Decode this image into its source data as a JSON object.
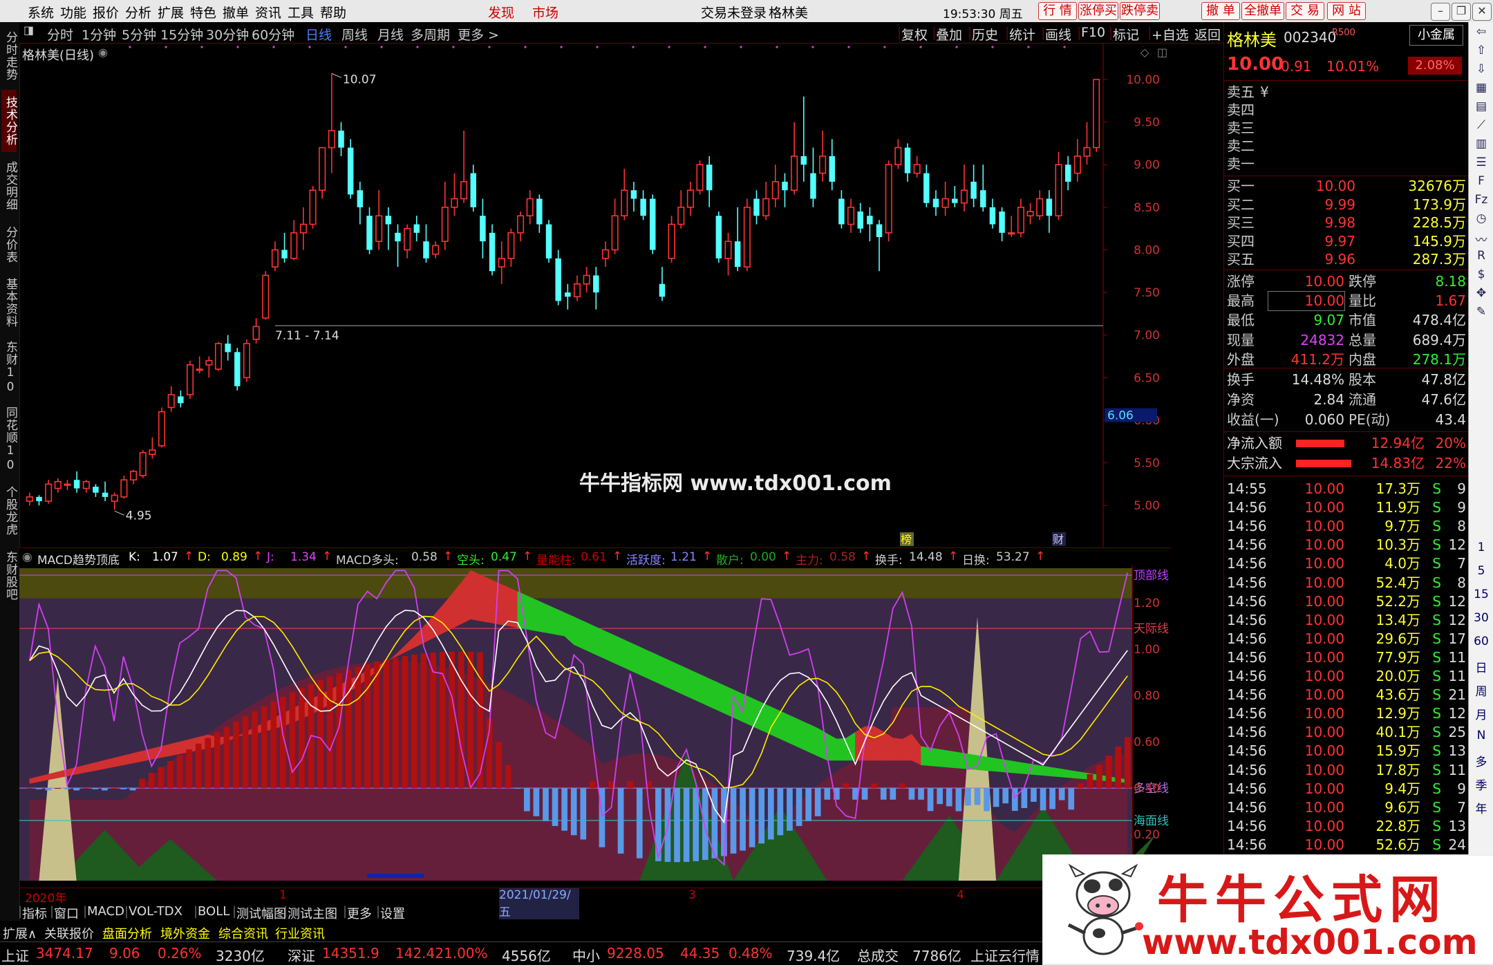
{
  "menu": {
    "items": [
      "系统",
      "功能",
      "报价",
      "分析",
      "扩展",
      "特色",
      "撤单",
      "资讯",
      "工具",
      "帮助"
    ],
    "highlight": [
      "发现",
      "市场"
    ],
    "status": "交易未登录",
    "stock_name": "格林美",
    "time": "19:53:30 周五",
    "right_buttons": [
      "行 情",
      "涨停买",
      "跌停卖",
      "撤 单",
      "全撤单",
      "交 易",
      "网 站"
    ]
  },
  "left_tabs": [
    "分时走势",
    "技术分析",
    "成交明细",
    "分价表",
    "基本资料",
    "东财10",
    "同花顺10",
    "个股龙虎",
    "东财股吧"
  ],
  "periods": [
    "分时",
    "1分钟",
    "5分钟",
    "15分钟",
    "30分钟",
    "60分钟",
    "日线",
    "周线",
    "月线",
    "多周期",
    "更多 >"
  ],
  "selected_period": "日线",
  "toolbar_right": [
    "复权",
    "叠加",
    "历史",
    "统计",
    "画线",
    "F10",
    "标记",
    "+自选",
    "返回"
  ],
  "chart_title": "格林美(日线)",
  "chart_data": [
    {
      "type": "candlestick",
      "price_axis": [
        "10.00",
        "9.50",
        "9.00",
        "8.50",
        "8.00",
        "7.50",
        "7.00",
        "6.50",
        "6.00",
        "5.50",
        "5.00"
      ],
      "ylim": [
        4.75,
        10.3
      ],
      "annotations": [
        "10.07",
        "7.11 - 7.14",
        "4.95"
      ],
      "current_price_label": "6.06",
      "markers": [
        "榜",
        "财"
      ],
      "candles": [
        [
          5.05,
          5.1,
          5.0,
          5.15
        ],
        [
          5.1,
          5.05,
          5.0,
          5.12
        ],
        [
          5.05,
          5.25,
          5.02,
          5.3
        ],
        [
          5.2,
          5.28,
          5.15,
          5.32
        ],
        [
          5.25,
          5.25,
          5.18,
          5.3
        ],
        [
          5.3,
          5.2,
          5.15,
          5.4
        ],
        [
          5.2,
          5.28,
          5.15,
          5.3
        ],
        [
          5.22,
          5.15,
          5.1,
          5.25
        ],
        [
          5.15,
          5.1,
          5.05,
          5.28
        ],
        [
          5.05,
          5.12,
          4.95,
          5.15
        ],
        [
          5.1,
          5.3,
          5.08,
          5.35
        ],
        [
          5.3,
          5.4,
          5.25,
          5.42
        ],
        [
          5.35,
          5.62,
          5.32,
          5.65
        ],
        [
          5.6,
          5.65,
          5.55,
          5.8
        ],
        [
          5.7,
          6.1,
          5.68,
          6.15
        ],
        [
          6.15,
          6.3,
          6.1,
          6.4
        ],
        [
          6.28,
          6.2,
          6.15,
          6.35
        ],
        [
          6.3,
          6.65,
          6.25,
          6.7
        ],
        [
          6.6,
          6.6,
          6.55,
          6.75
        ],
        [
          6.65,
          6.7,
          6.5,
          6.75
        ],
        [
          6.6,
          6.9,
          6.58,
          6.92
        ],
        [
          6.9,
          6.8,
          6.7,
          7.0
        ],
        [
          6.8,
          6.4,
          6.35,
          6.85
        ],
        [
          6.5,
          6.9,
          6.45,
          6.95
        ],
        [
          6.95,
          7.1,
          6.9,
          7.2
        ],
        [
          7.2,
          7.7,
          7.18,
          7.75
        ],
        [
          7.8,
          8.0,
          7.75,
          8.1
        ],
        [
          8.0,
          7.9,
          7.85,
          8.2
        ],
        [
          7.9,
          8.2,
          7.88,
          8.35
        ],
        [
          8.2,
          8.3,
          8.0,
          8.5
        ],
        [
          8.3,
          8.7,
          8.25,
          8.75
        ],
        [
          8.7,
          9.2,
          8.6,
          9.2
        ],
        [
          9.2,
          9.4,
          8.9,
          10.07
        ],
        [
          9.4,
          9.2,
          9.1,
          9.5
        ],
        [
          9.2,
          8.65,
          8.6,
          9.3
        ],
        [
          8.7,
          8.5,
          8.3,
          8.8
        ],
        [
          8.4,
          8.0,
          7.95,
          8.5
        ],
        [
          8.1,
          8.4,
          8.0,
          8.7
        ],
        [
          8.4,
          8.3,
          8.0,
          8.5
        ],
        [
          8.2,
          8.1,
          7.8,
          8.3
        ],
        [
          8.0,
          8.25,
          7.9,
          8.3
        ],
        [
          8.3,
          8.2,
          8.1,
          8.4
        ],
        [
          8.1,
          7.9,
          7.85,
          8.3
        ],
        [
          7.95,
          8.05,
          7.9,
          8.1
        ],
        [
          8.1,
          8.5,
          8.0,
          8.8
        ],
        [
          8.5,
          8.6,
          8.4,
          8.9
        ],
        [
          8.6,
          8.8,
          8.55,
          9.4
        ],
        [
          8.9,
          8.5,
          8.45,
          9.0
        ],
        [
          8.4,
          8.1,
          7.9,
          8.6
        ],
        [
          8.2,
          7.75,
          7.7,
          8.3
        ],
        [
          7.8,
          7.9,
          7.6,
          8.1
        ],
        [
          7.9,
          8.2,
          7.8,
          8.25
        ],
        [
          8.2,
          8.4,
          8.1,
          8.45
        ],
        [
          8.4,
          8.6,
          8.3,
          8.7
        ],
        [
          8.6,
          8.3,
          8.2,
          8.65
        ],
        [
          8.3,
          7.9,
          7.85,
          8.35
        ],
        [
          7.9,
          7.4,
          7.35,
          8.0
        ],
        [
          7.5,
          7.45,
          7.3,
          7.6
        ],
        [
          7.45,
          7.6,
          7.4,
          7.7
        ],
        [
          7.6,
          7.7,
          7.5,
          7.8
        ],
        [
          7.7,
          7.5,
          7.3,
          7.8
        ],
        [
          7.9,
          8.0,
          7.8,
          8.1
        ],
        [
          8.0,
          8.4,
          7.95,
          8.6
        ],
        [
          8.4,
          8.7,
          8.35,
          8.95
        ],
        [
          8.7,
          8.6,
          8.45,
          8.8
        ],
        [
          8.6,
          8.4,
          8.35,
          8.7
        ],
        [
          8.6,
          8.0,
          7.95,
          8.65
        ],
        [
          7.6,
          7.45,
          7.4,
          7.8
        ],
        [
          7.9,
          8.3,
          7.85,
          8.4
        ],
        [
          8.3,
          8.5,
          8.25,
          8.7
        ],
        [
          8.5,
          8.7,
          8.4,
          8.8
        ],
        [
          8.7,
          9.0,
          8.65,
          9.05
        ],
        [
          9.0,
          8.7,
          8.5,
          9.1
        ],
        [
          8.4,
          7.9,
          7.85,
          8.45
        ],
        [
          7.9,
          8.1,
          7.7,
          8.2
        ],
        [
          8.1,
          7.8,
          7.75,
          8.5
        ],
        [
          7.8,
          8.5,
          7.75,
          8.6
        ],
        [
          8.6,
          8.4,
          8.3,
          8.7
        ],
        [
          8.4,
          8.6,
          8.35,
          8.8
        ],
        [
          8.6,
          8.8,
          8.5,
          9.0
        ],
        [
          8.8,
          8.7,
          8.5,
          8.9
        ],
        [
          8.7,
          9.1,
          8.65,
          9.5
        ],
        [
          9.1,
          9.0,
          8.8,
          9.8
        ],
        [
          8.9,
          8.6,
          8.5,
          9.2
        ],
        [
          8.9,
          9.1,
          8.8,
          9.4
        ],
        [
          9.1,
          8.8,
          8.7,
          9.3
        ],
        [
          8.6,
          8.3,
          8.25,
          8.7
        ],
        [
          8.3,
          8.5,
          8.2,
          8.6
        ],
        [
          8.45,
          8.25,
          8.2,
          8.55
        ],
        [
          8.4,
          8.3,
          8.1,
          8.5
        ],
        [
          8.3,
          8.15,
          7.75,
          8.35
        ],
        [
          8.2,
          9.0,
          8.1,
          9.05
        ],
        [
          9.0,
          9.2,
          8.95,
          9.3
        ],
        [
          9.2,
          8.9,
          8.8,
          9.25
        ],
        [
          8.9,
          9.0,
          8.85,
          9.1
        ],
        [
          8.9,
          8.55,
          8.5,
          9.0
        ],
        [
          8.6,
          8.5,
          8.4,
          8.7
        ],
        [
          8.5,
          8.6,
          8.4,
          8.8
        ],
        [
          8.6,
          8.55,
          8.5,
          8.75
        ],
        [
          8.55,
          8.7,
          8.45,
          9.0
        ],
        [
          8.8,
          8.6,
          8.5,
          9.0
        ],
        [
          8.7,
          8.5,
          8.45,
          9.0
        ],
        [
          8.5,
          8.3,
          8.25,
          8.6
        ],
        [
          8.45,
          8.2,
          8.1,
          8.5
        ],
        [
          8.2,
          8.2,
          8.15,
          8.4
        ],
        [
          8.2,
          8.5,
          8.15,
          8.6
        ],
        [
          8.4,
          8.45,
          8.3,
          8.55
        ],
        [
          8.4,
          8.6,
          8.35,
          8.7
        ],
        [
          8.6,
          8.4,
          8.2,
          8.7
        ],
        [
          8.4,
          9.0,
          8.35,
          9.15
        ],
        [
          9.0,
          8.8,
          8.7,
          9.1
        ],
        [
          8.9,
          9.1,
          8.8,
          9.3
        ],
        [
          9.1,
          9.2,
          9.0,
          9.5
        ],
        [
          9.2,
          10.0,
          9.15,
          10.0
        ]
      ]
    },
    {
      "type": "indicator",
      "name": "MACD趋势顶底",
      "values": {
        "K": "1.07",
        "D": "0.89",
        "J": "1.34",
        "MACD多头": "0.58",
        "空头": "0.47",
        "量能柱": "0.61",
        "活跃度": "1.21",
        "散户": "0.00",
        "主力": "0.58",
        "换手": "14.48",
        "日换": "53.27"
      },
      "axis": [
        "1.20",
        "1.00",
        "0.80",
        "0.60",
        "0.40",
        "0.20"
      ],
      "ylim": [
        0.0,
        1.35
      ],
      "levels": [
        {
          "label": "顶部线",
          "value": 1.32,
          "color": "#c040ff"
        },
        {
          "label": "天际线",
          "value": 1.09,
          "color": "#e04050"
        },
        {
          "label": "多空线",
          "value": 0.4,
          "color": "#b070e0"
        },
        {
          "label": "海面线",
          "value": 0.26,
          "color": "#30c0c0"
        }
      ]
    }
  ],
  "sub_header": {
    "name": "MACD趋势顶底",
    "items": [
      {
        "k": "K:",
        "v": "1.07",
        "c": "#ffffff"
      },
      {
        "k": "D:",
        "v": "0.89",
        "c": "#ffff00"
      },
      {
        "k": "J:",
        "v": "1.34",
        "c": "#e040ff"
      },
      {
        "k": "MACD多头:",
        "v": "0.58",
        "c": "#cccccc"
      },
      {
        "k": "空头:",
        "v": "0.47",
        "c": "#33ee33"
      },
      {
        "k": "量能柱:",
        "v": "0.61",
        "c": "#cc0000"
      },
      {
        "k": "活跃度:",
        "v": "1.21",
        "c": "#8888ff"
      },
      {
        "k": "散户:",
        "v": "0.00",
        "c": "#22aa22"
      },
      {
        "k": "主力:",
        "v": "0.58",
        "c": "#aa2222"
      },
      {
        "k": "换手:",
        "v": "14.48",
        "c": "#cccccc"
      },
      {
        "k": "日换:",
        "v": "53.27",
        "c": "#cccccc"
      }
    ]
  },
  "date_axis": {
    "start": "2020年",
    "mark1": "1",
    "highlight": "2021/01/29/五",
    "mark3": "3",
    "mark4": "4"
  },
  "indicator_tabs": [
    "指标",
    "窗口",
    "MACD",
    "VOL-TDX",
    "BOLL",
    "测试幅图",
    "测试主图",
    "更多",
    "设置"
  ],
  "bottom_tabs": [
    "扩展∧",
    "关联报价",
    "盘面分析",
    "境外资金",
    "综合资讯",
    "行业资讯"
  ],
  "status": [
    {
      "name": "上证",
      "price": "3474.17",
      "chg": "9.06",
      "pct": "0.26%",
      "amt": "3230亿"
    },
    {
      "name": "深证",
      "price": "14351.9",
      "chg": "142.42",
      "pct": "1.00%",
      "amt": "4556亿"
    },
    {
      "name": "中小",
      "price": "9228.05",
      "chg": "44.35",
      "pct": "0.48%",
      "amt": "739.4亿"
    }
  ],
  "status_total": {
    "label": "总成交",
    "value": "7786亿"
  },
  "status_tail": "上证云行情",
  "watermark": "牛牛指标网 www.tdx001.com",
  "ad": {
    "title": "牛牛公式网",
    "url": "www.tdx001.com"
  },
  "quote": {
    "name": "格林美",
    "code": "002340",
    "badge": "R500",
    "tag": "小金属",
    "price": "10.00",
    "change": "0.91",
    "pct": "10.01%",
    "amp": "2.08%",
    "asks": [
      {
        "l": "卖五",
        "p": "¥",
        "v": ""
      },
      {
        "l": "卖四",
        "p": "",
        "v": ""
      },
      {
        "l": "卖三",
        "p": "",
        "v": ""
      },
      {
        "l": "卖二",
        "p": "",
        "v": ""
      },
      {
        "l": "卖一",
        "p": "",
        "v": ""
      }
    ],
    "bids": [
      {
        "l": "买一",
        "p": "10.00",
        "v": "32676万"
      },
      {
        "l": "买二",
        "p": "9.99",
        "v": "173.9万"
      },
      {
        "l": "买三",
        "p": "9.98",
        "v": "228.5万"
      },
      {
        "l": "买四",
        "p": "9.97",
        "v": "145.9万"
      },
      {
        "l": "买五",
        "p": "9.96",
        "v": "287.3万"
      }
    ],
    "stats": [
      {
        "l1": "涨停",
        "v1": "10.00",
        "c1": "#ff3333",
        "l2": "跌停",
        "v2": "8.18",
        "c2": "#33ee33"
      },
      {
        "l1": "最高",
        "v1": "10.00",
        "c1": "#ff3333",
        "l2": "量比",
        "v2": "1.67",
        "c2": "#ff3333"
      },
      {
        "l1": "最低",
        "v1": "9.07",
        "c1": "#33ee33",
        "l2": "市值",
        "v2": "478.4亿",
        "c2": "#dddddd"
      },
      {
        "l1": "现量",
        "v1": "24832",
        "c1": "#e040ff",
        "l2": "总量",
        "v2": "689.4万",
        "c2": "#dddddd"
      },
      {
        "l1": "外盘",
        "v1": "411.2万",
        "c1": "#ff3333",
        "l2": "内盘",
        "v2": "278.1万",
        "c2": "#33ee33"
      }
    ],
    "stats2": [
      {
        "l1": "换手",
        "v1": "14.48%",
        "l2": "股本",
        "v2": "47.8亿"
      },
      {
        "l1": "净资",
        "v1": "2.84",
        "l2": "流通",
        "v2": "47.6亿"
      },
      {
        "l1": "收益(一)",
        "v1": "0.060",
        "l2": "PE(动)",
        "v2": "43.4"
      }
    ],
    "flows": [
      {
        "l": "净流入额",
        "v": "12.94亿",
        "p": "20%"
      },
      {
        "l": "大宗流入",
        "v": "14.83亿",
        "p": "22%"
      }
    ],
    "ticks": [
      {
        "t": "14:55",
        "p": "10.00",
        "v": "17.3万",
        "s": "S",
        "n": "9"
      },
      {
        "t": "14:56",
        "p": "10.00",
        "v": "11.9万",
        "s": "S",
        "n": "9"
      },
      {
        "t": "14:56",
        "p": "10.00",
        "v": "9.7万",
        "s": "S",
        "n": "8"
      },
      {
        "t": "14:56",
        "p": "10.00",
        "v": "10.3万",
        "s": "S",
        "n": "12"
      },
      {
        "t": "14:56",
        "p": "10.00",
        "v": "4.0万",
        "s": "S",
        "n": "7"
      },
      {
        "t": "14:56",
        "p": "10.00",
        "v": "52.4万",
        "s": "S",
        "n": "8"
      },
      {
        "t": "14:56",
        "p": "10.00",
        "v": "52.2万",
        "s": "S",
        "n": "12"
      },
      {
        "t": "14:56",
        "p": "10.00",
        "v": "13.4万",
        "s": "S",
        "n": "12"
      },
      {
        "t": "14:56",
        "p": "10.00",
        "v": "29.6万",
        "s": "S",
        "n": "17"
      },
      {
        "t": "14:56",
        "p": "10.00",
        "v": "77.9万",
        "s": "S",
        "n": "11"
      },
      {
        "t": "14:56",
        "p": "10.00",
        "v": "20.0万",
        "s": "S",
        "n": "11"
      },
      {
        "t": "14:56",
        "p": "10.00",
        "v": "43.6万",
        "s": "S",
        "n": "21"
      },
      {
        "t": "14:56",
        "p": "10.00",
        "v": "12.9万",
        "s": "S",
        "n": "12"
      },
      {
        "t": "14:56",
        "p": "10.00",
        "v": "40.1万",
        "s": "S",
        "n": "25"
      },
      {
        "t": "14:56",
        "p": "10.00",
        "v": "15.9万",
        "s": "S",
        "n": "13"
      },
      {
        "t": "14:56",
        "p": "10.00",
        "v": "17.8万",
        "s": "S",
        "n": "11"
      },
      {
        "t": "14:56",
        "p": "10.00",
        "v": "9.4万",
        "s": "S",
        "n": "9"
      },
      {
        "t": "14:56",
        "p": "10.00",
        "v": "9.6万",
        "s": "S",
        "n": "7"
      },
      {
        "t": "14:56",
        "p": "10.00",
        "v": "22.8万",
        "s": "S",
        "n": "13"
      },
      {
        "t": "14:56",
        "p": "10.00",
        "v": "52.6万",
        "s": "S",
        "n": "24"
      }
    ]
  },
  "right_icons": [
    "back-icon",
    "up-icon",
    "down-icon",
    "chart-icon",
    "grid-icon",
    "line-icon",
    "candle-icon",
    "list-icon",
    "f10-icon",
    "fiz-icon",
    "clock-icon",
    "wave-icon",
    "rsi-icon",
    "money-icon",
    "move-icon",
    "pen-icon"
  ],
  "right_period_labels": [
    "1",
    "5",
    "15",
    "30",
    "60",
    "日",
    "周",
    "月",
    "N",
    "多",
    "季",
    "年"
  ]
}
